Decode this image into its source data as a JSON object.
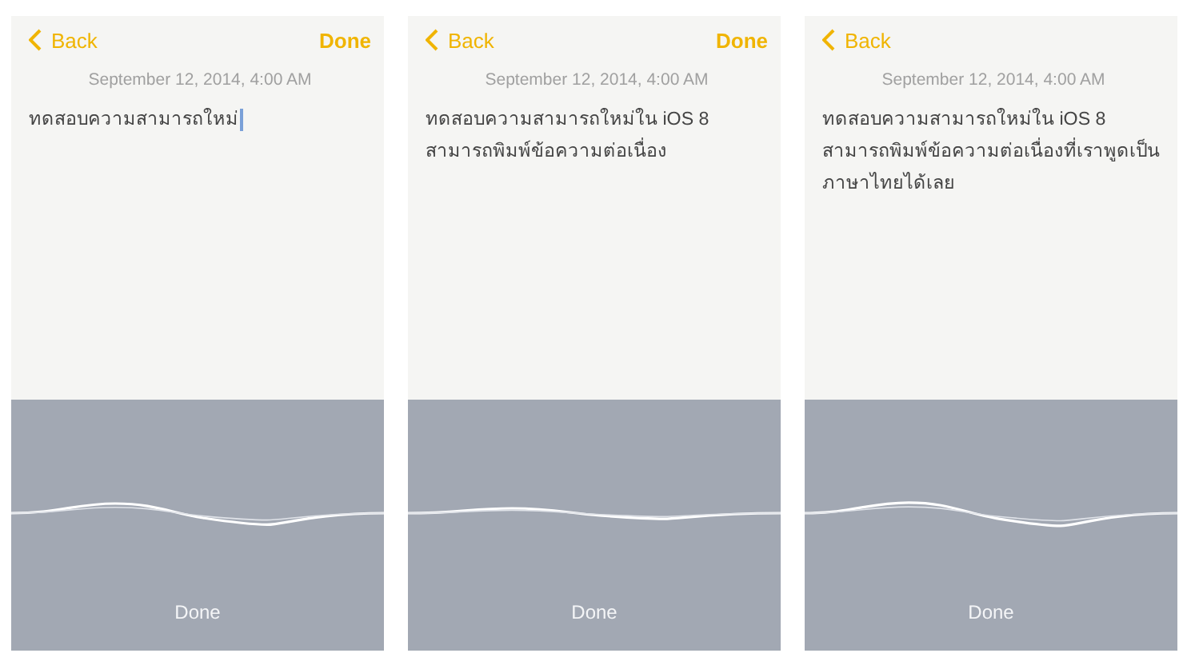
{
  "screens": [
    {
      "back": "Back",
      "done": "Done",
      "date": "September 12, 2014, 4:00 AM",
      "note": "ทดสอบความสามารถใหม่",
      "cursor": true,
      "dictation_done": "Done"
    },
    {
      "back": "Back",
      "done": "Done",
      "date": "September 12, 2014, 4:00 AM",
      "note": "ทดสอบความสามารถใหม่ใน iOS 8 สามารถพิมพ์ข้อความต่อเนื่อง",
      "cursor": false,
      "dictation_done": "Done"
    },
    {
      "back": "Back",
      "date": "September 12, 2014, 4:00 AM",
      "note": "ทดสอบความสามารถใหม่ใน iOS 8 สามารถพิมพ์ข้อความต่อเนื่องที่เราพูดเป็นภาษาไทยได้เลย",
      "cursor": false,
      "dictation_done": "Done"
    }
  ]
}
